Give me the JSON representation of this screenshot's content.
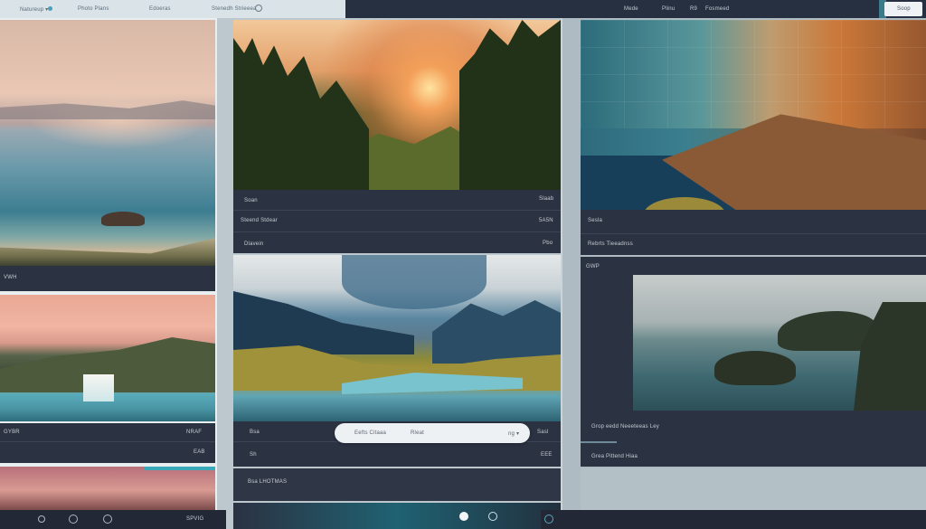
{
  "topbar": {
    "left_items": [
      "Natureup ▾",
      "Photo Plans",
      "Edoeras",
      "Stenedh Strieeea"
    ],
    "right_items": [
      "Mede",
      "Plinu",
      "R9",
      "Fosmeed"
    ],
    "button_label": "Soop"
  },
  "col1": {
    "bar_lake": {
      "left": "VWH"
    },
    "bar_waterfall": {
      "left": "GYBR",
      "right_top": "NRAF",
      "right_bottom": "EAB"
    },
    "bottom": {
      "icons": [
        "gear-icon",
        "globe-icon",
        "target-icon"
      ],
      "right": "SPVIG"
    }
  },
  "col2": {
    "bar_forest": {
      "rows": [
        {
          "left": "Soan",
          "right": "Slaab"
        },
        {
          "left": "Steend Stdear",
          "right": "5A5N"
        },
        {
          "left": "Dlavein",
          "right": "Pbo"
        }
      ]
    },
    "bar_mountain": {
      "left": "Bsa",
      "left2": "Sh",
      "right": "Sasl"
    },
    "search": {
      "left": "Eefts Citaaa",
      "middle": "Rleat",
      "right": "ng ▾"
    },
    "bar_bottom2": {
      "left": "Bsa LHOTMAS",
      "right": "EEE"
    }
  },
  "col3": {
    "bar_deck": {
      "left": "Sesla",
      "left2": "Rebrts Tieeadnss"
    },
    "panel_sea": {
      "title": "GWP"
    },
    "bar_sea": {
      "row1": "Grop eedd Neeeteeas Ley",
      "row2": "Grea Pittend Hiaa"
    }
  },
  "colors": {
    "dark_panel": "#2b3242",
    "topbar_dark": "#263040",
    "accent": "#3aa9b8"
  }
}
